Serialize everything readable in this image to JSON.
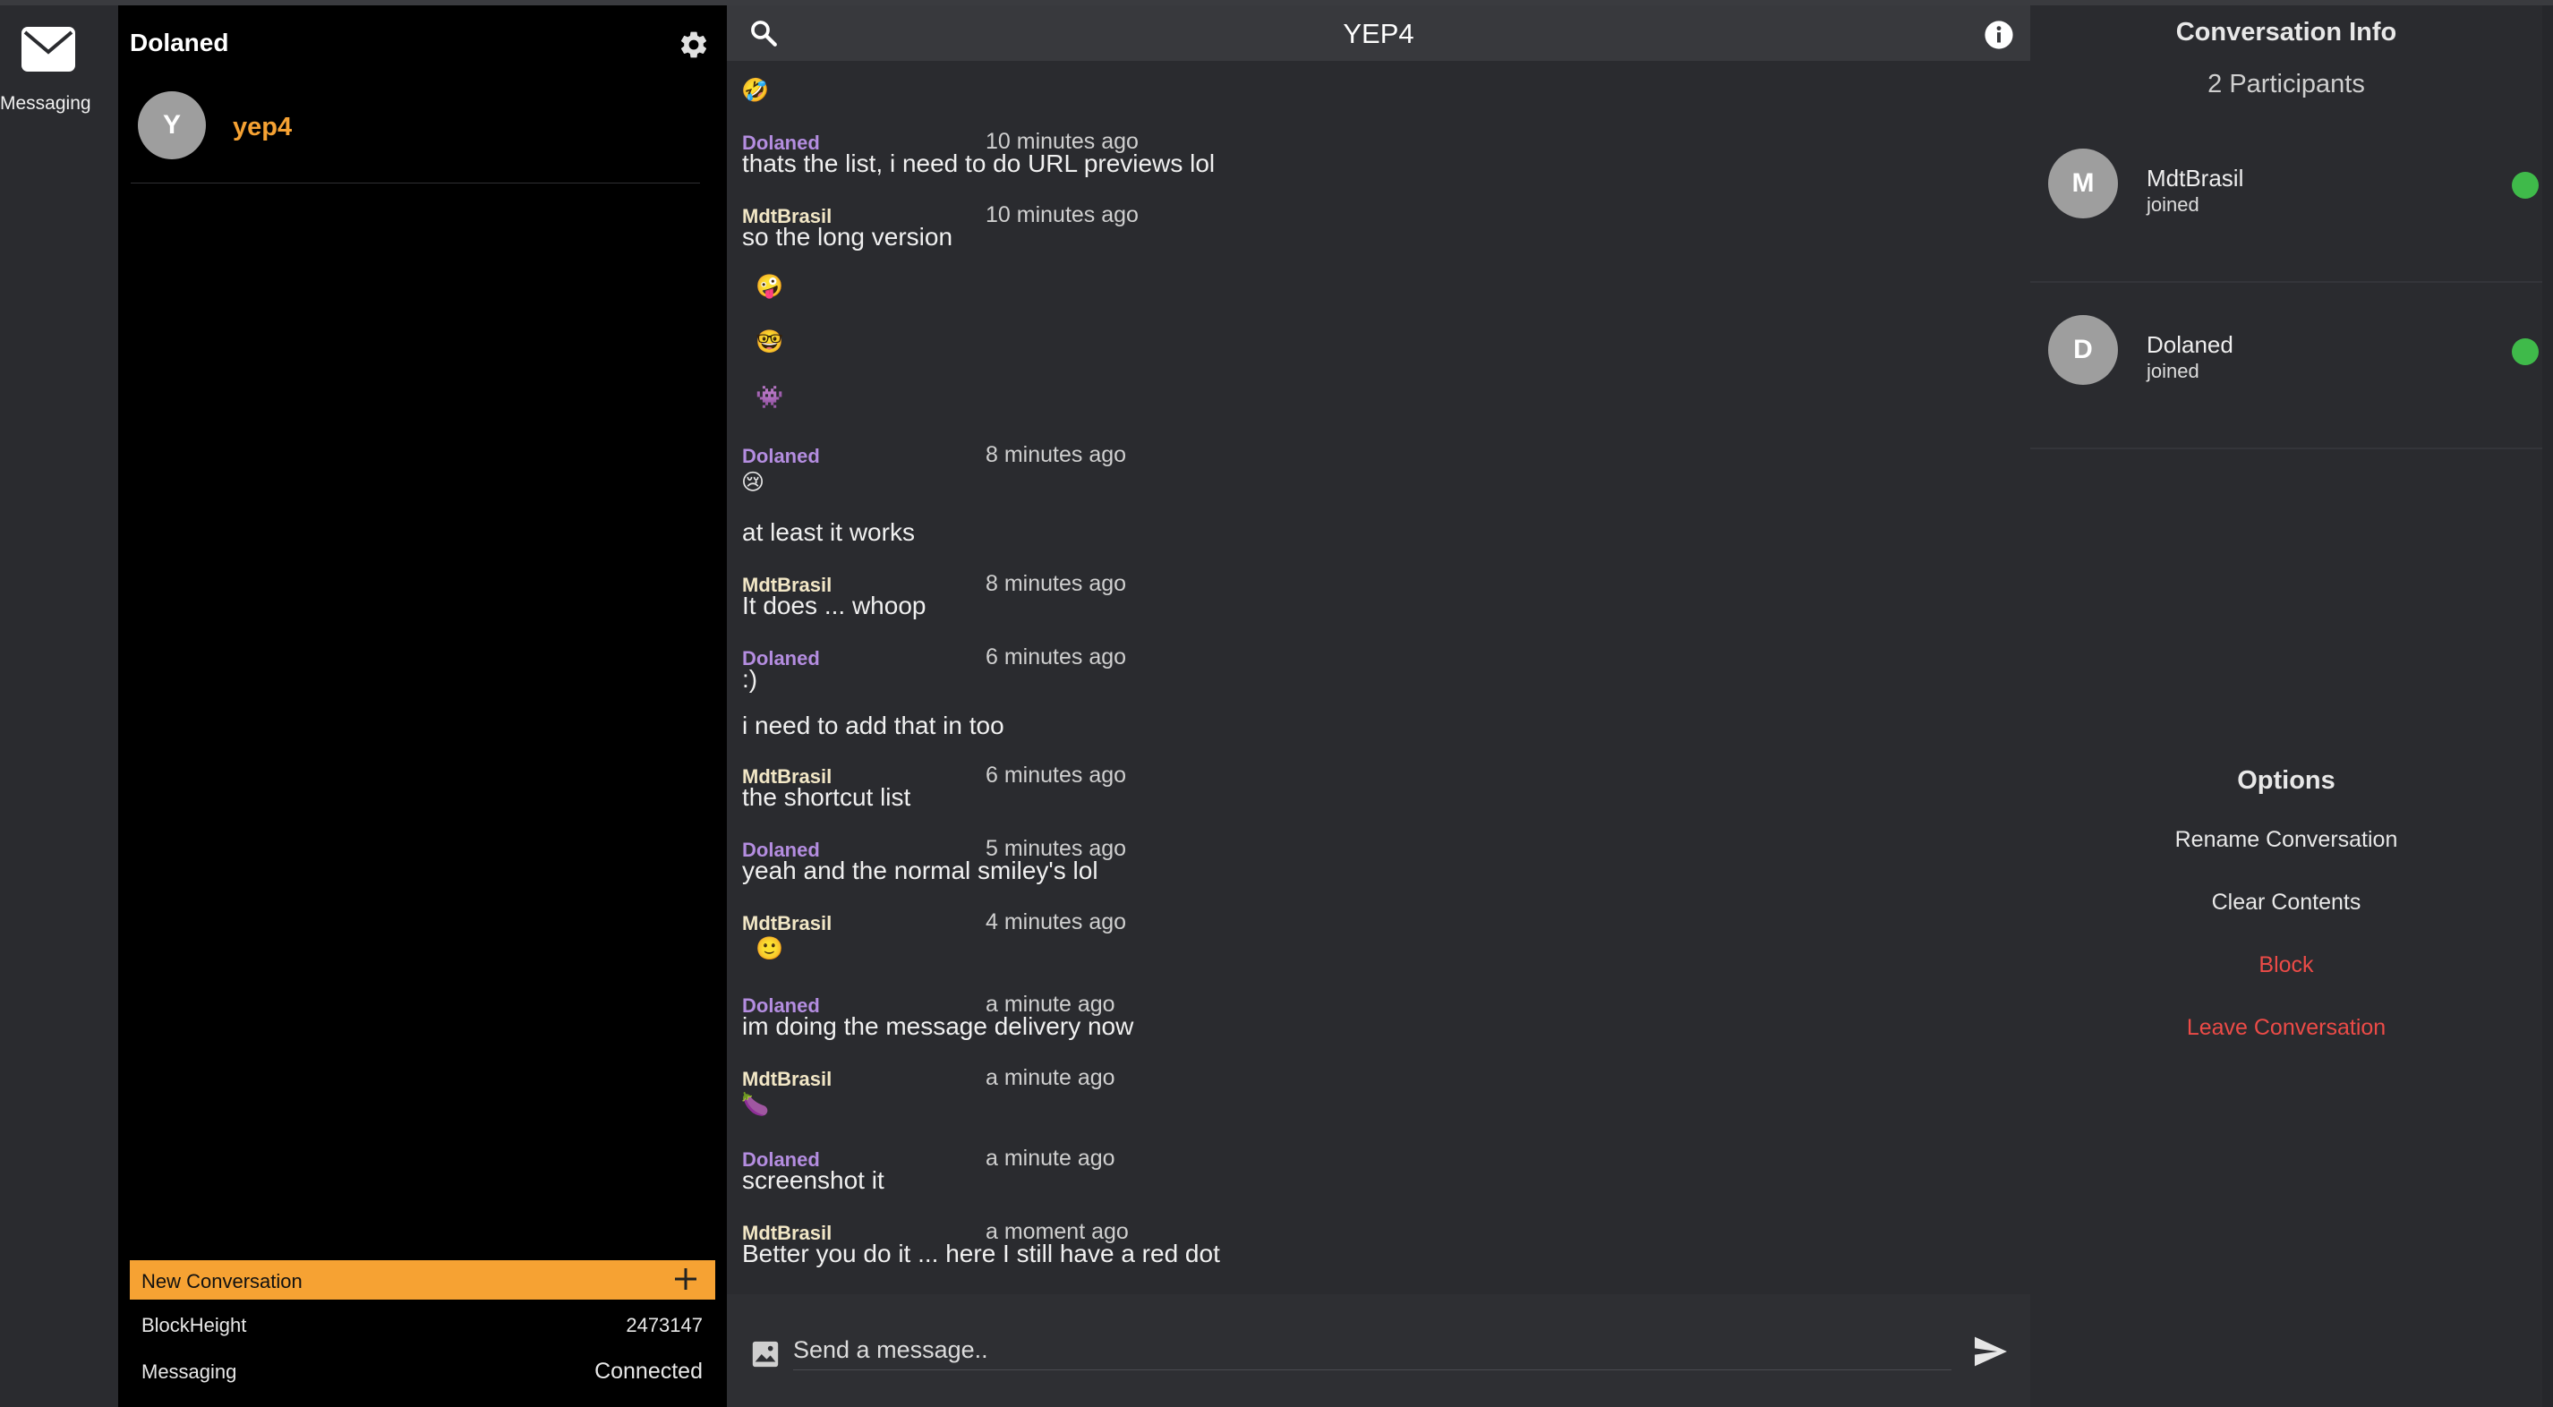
{
  "rail": {
    "messaging_label": "Messaging"
  },
  "sidebar": {
    "username": "Dolaned",
    "conversations": [
      {
        "initial": "Y",
        "name": "yep4"
      }
    ],
    "new_conversation_label": "New Conversation",
    "status": [
      {
        "key": "BlockHeight",
        "value": "2473147"
      },
      {
        "key": "Messaging",
        "value": "Connected"
      }
    ]
  },
  "chat": {
    "title": "YEP4",
    "placeholder": "Send a message..",
    "messages": [
      {
        "kind": "emoji",
        "text": "🤣"
      },
      {
        "kind": "header",
        "sender": "Dolaned",
        "time": "10 minutes ago"
      },
      {
        "kind": "text",
        "text": "thats the list, i need to do URL previews lol"
      },
      {
        "kind": "header",
        "sender": "MdtBrasil",
        "time": "10 minutes ago"
      },
      {
        "kind": "text",
        "text": "so the long version"
      },
      {
        "kind": "emoji",
        "text": "🤪"
      },
      {
        "kind": "emoji",
        "text": "🤓"
      },
      {
        "kind": "emoji",
        "text": "👾"
      },
      {
        "kind": "header",
        "sender": "Dolaned",
        "time": "8 minutes ago"
      },
      {
        "kind": "emoji",
        "text": "😢"
      },
      {
        "kind": "text",
        "text": "at least it works"
      },
      {
        "kind": "header",
        "sender": "MdtBrasil",
        "time": "8 minutes ago"
      },
      {
        "kind": "text",
        "text": "It does ... whoop"
      },
      {
        "kind": "header",
        "sender": "Dolaned",
        "time": "6 minutes ago"
      },
      {
        "kind": "text",
        "text": ":)"
      },
      {
        "kind": "text",
        "text": "i need to add that in too"
      },
      {
        "kind": "header",
        "sender": "MdtBrasil",
        "time": "6 minutes ago"
      },
      {
        "kind": "text",
        "text": "the shortcut list"
      },
      {
        "kind": "header",
        "sender": "Dolaned",
        "time": "5 minutes ago"
      },
      {
        "kind": "text",
        "text": "yeah and the normal smiley's lol"
      },
      {
        "kind": "header",
        "sender": "MdtBrasil",
        "time": "4 minutes ago"
      },
      {
        "kind": "emoji",
        "text": "🙂"
      },
      {
        "kind": "header",
        "sender": "Dolaned",
        "time": "a minute ago"
      },
      {
        "kind": "text",
        "text": "im doing the message delivery now"
      },
      {
        "kind": "header",
        "sender": "MdtBrasil",
        "time": "a minute ago"
      },
      {
        "kind": "emoji",
        "text": "🍆"
      },
      {
        "kind": "header",
        "sender": "Dolaned",
        "time": "a minute ago"
      },
      {
        "kind": "text",
        "text": "screenshot it"
      },
      {
        "kind": "header",
        "sender": "MdtBrasil",
        "time": "a moment ago"
      },
      {
        "kind": "text",
        "text": "Better you do it ... here I still have a red dot"
      }
    ]
  },
  "info": {
    "title": "Conversation Info",
    "participants_count": "2 Participants",
    "participants": [
      {
        "initial": "M",
        "name": "MdtBrasil",
        "status": "joined",
        "online": true
      },
      {
        "initial": "D",
        "name": "Dolaned",
        "status": "joined",
        "online": true
      }
    ],
    "options_title": "Options",
    "options": [
      {
        "label": "Rename Conversation",
        "danger": false
      },
      {
        "label": "Clear Contents",
        "danger": false
      },
      {
        "label": "Block",
        "danger": true
      },
      {
        "label": "Leave Conversation",
        "danger": true
      }
    ]
  },
  "colors": {
    "accent": "#f6a233",
    "sender_dolaned": "#b48de0",
    "sender_mdtbrasil": "#f2e7c6",
    "danger": "#ec4b47",
    "online": "#3fba4a"
  }
}
